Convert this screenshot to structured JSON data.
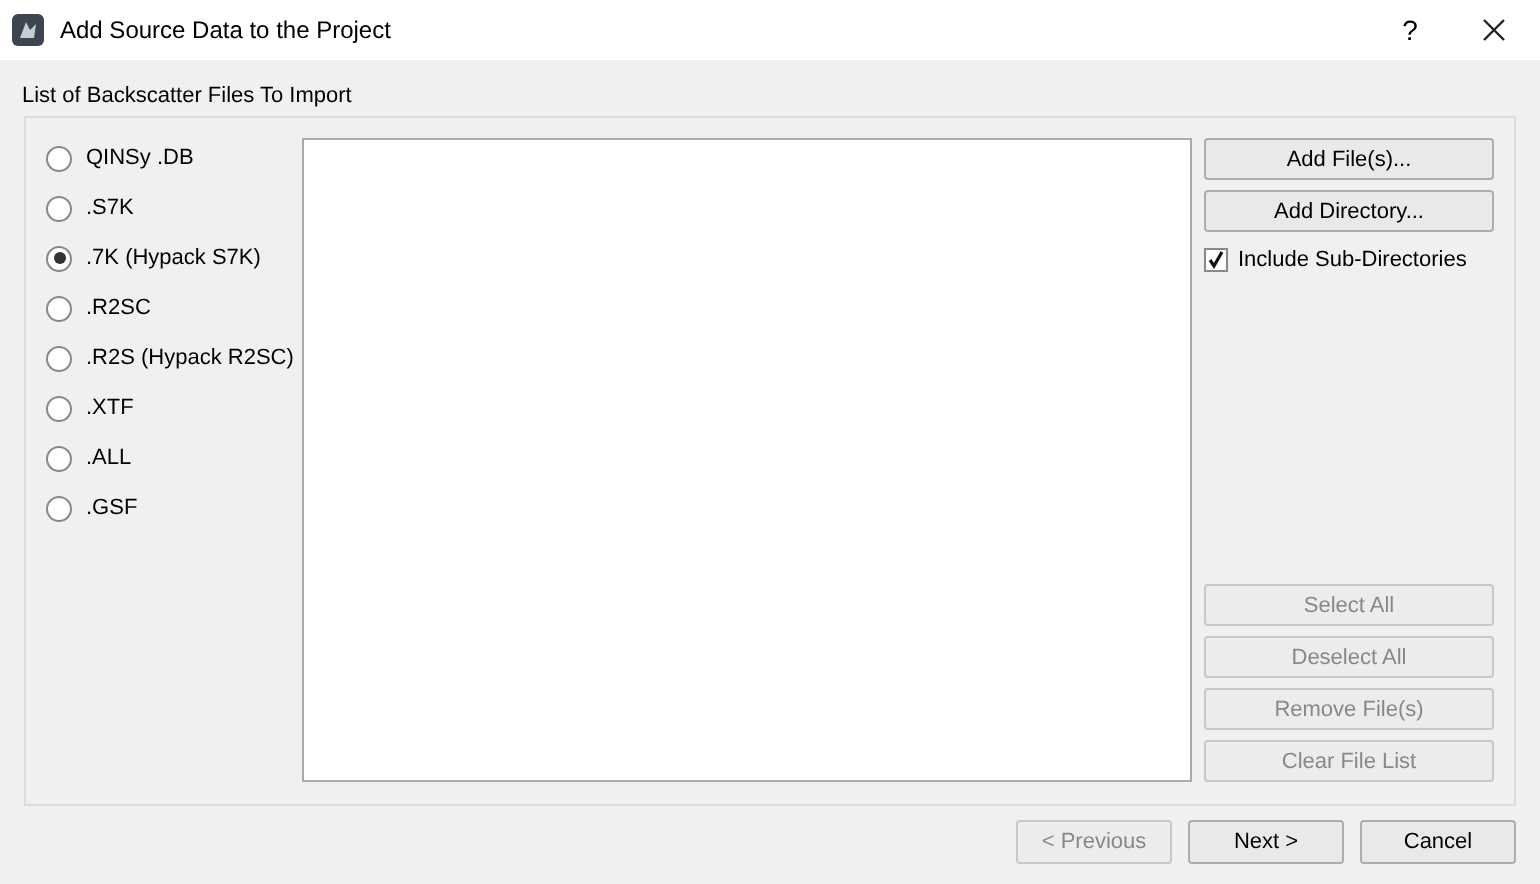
{
  "window": {
    "title": "Add Source Data to the Project",
    "help": "?"
  },
  "group_label": "List of Backscatter Files To Import",
  "formats": [
    {
      "label": "QINSy .DB",
      "selected": false
    },
    {
      "label": ".S7K",
      "selected": false
    },
    {
      "label": ".7K (Hypack S7K)",
      "selected": true
    },
    {
      "label": ".R2SC",
      "selected": false
    },
    {
      "label": ".R2S (Hypack R2SC)",
      "selected": false
    },
    {
      "label": ".XTF",
      "selected": false
    },
    {
      "label": ".ALL",
      "selected": false
    },
    {
      "label": ".GSF",
      "selected": false
    }
  ],
  "top_buttons": [
    {
      "label": "Add File(s)...",
      "disabled": false
    },
    {
      "label": "Add Directory...",
      "disabled": false
    }
  ],
  "include_subdirs": {
    "label": "Include Sub-Directories",
    "checked": true
  },
  "bottom_buttons": [
    {
      "label": "Select All",
      "disabled": true
    },
    {
      "label": "Deselect All",
      "disabled": true
    },
    {
      "label": "Remove File(s)",
      "disabled": true
    },
    {
      "label": "Clear File List",
      "disabled": true
    }
  ],
  "footer_buttons": [
    {
      "label": "< Previous",
      "disabled": true
    },
    {
      "label": "Next >",
      "disabled": false
    },
    {
      "label": "Cancel",
      "disabled": false
    }
  ]
}
